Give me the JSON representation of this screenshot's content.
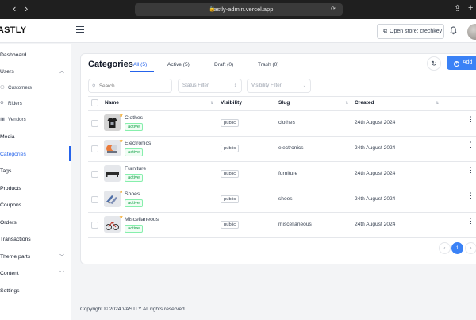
{
  "browser": {
    "url": "vastly-admin.vercel.app",
    "back_icon": "chevron-left-icon",
    "forward_icon": "chevron-right-icon"
  },
  "header": {
    "logo": "VASTLY",
    "store_button": "Open store: ctechkey"
  },
  "sidebar": {
    "items": [
      {
        "label": "Dashboard"
      },
      {
        "label": "Users"
      },
      {
        "label": "Customers"
      },
      {
        "label": "Riders"
      },
      {
        "label": "Vendors"
      },
      {
        "label": "Media"
      },
      {
        "label": "Categories"
      },
      {
        "label": "Tags"
      },
      {
        "label": "Products"
      },
      {
        "label": "Coupons"
      },
      {
        "label": "Orders"
      },
      {
        "label": "Transactions"
      },
      {
        "label": "Theme parts"
      },
      {
        "label": "Content"
      },
      {
        "label": "Settings"
      }
    ],
    "active": "Categories"
  },
  "main": {
    "title": "Categories",
    "tabs": [
      {
        "label": "All (5)",
        "active": true
      },
      {
        "label": "Active (5)",
        "active": false
      },
      {
        "label": "Draft (0)",
        "active": false
      },
      {
        "label": "Trash (0)",
        "active": false
      }
    ],
    "add_label": "Add",
    "search_placeholder": "Search",
    "status_filter_placeholder": "Status Filter",
    "visibility_filter_placeholder": "Visibility Filter",
    "columns": [
      "Name",
      "Visibility",
      "Slug",
      "Created"
    ],
    "rows": [
      {
        "name": "Clothes",
        "status": "active",
        "visibility": "public",
        "slug": "clothes",
        "created": "24th August 2024"
      },
      {
        "name": "Electronics",
        "status": "active",
        "visibility": "public",
        "slug": "electronics",
        "created": "24th August 2024"
      },
      {
        "name": "Furniture",
        "status": "active",
        "visibility": "public",
        "slug": "furniture",
        "created": "24th August 2024"
      },
      {
        "name": "Shoes",
        "status": "active",
        "visibility": "public",
        "slug": "shoes",
        "created": "24th August 2024"
      },
      {
        "name": "Miscellaneous",
        "status": "active",
        "visibility": "public",
        "slug": "miscellaneous",
        "created": "24th August 2024"
      }
    ],
    "pagination": {
      "current": "1",
      "prev": "‹",
      "next": "›"
    }
  },
  "footer": {
    "text": "Copyright © 2024 VASTLY All rights reserved."
  },
  "colors": {
    "accent": "#3b82f6",
    "active_status": "#16a34a"
  }
}
